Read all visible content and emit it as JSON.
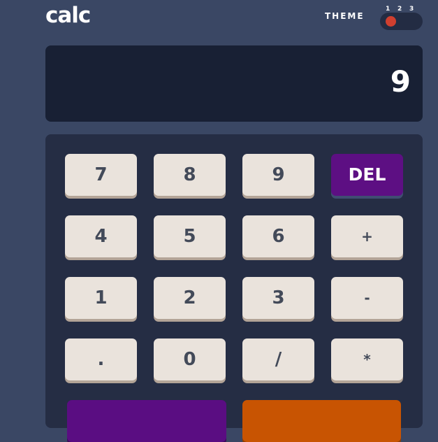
{
  "header": {
    "logo": "calc",
    "theme_label": "THEME",
    "theme_numbers": [
      "1",
      "2",
      "3"
    ],
    "selected_theme": 1
  },
  "display": {
    "value": "9"
  },
  "keypad": {
    "row1": [
      "7",
      "8",
      "9",
      "DEL"
    ],
    "row2": [
      "4",
      "5",
      "6",
      "+"
    ],
    "row3": [
      "1",
      "2",
      "3",
      "-"
    ],
    "row4": [
      ".",
      "0",
      "/",
      "*"
    ],
    "row5": [
      "",
      ""
    ]
  },
  "colors": {
    "background": "#3a4764",
    "screen": "#182034",
    "keypad": "#252d44",
    "key": "#eae3dc",
    "key_text": "#434a59",
    "del_key": "#5d0f83",
    "equals_key": "#c85402",
    "toggle_knob": "#d03f2f"
  }
}
